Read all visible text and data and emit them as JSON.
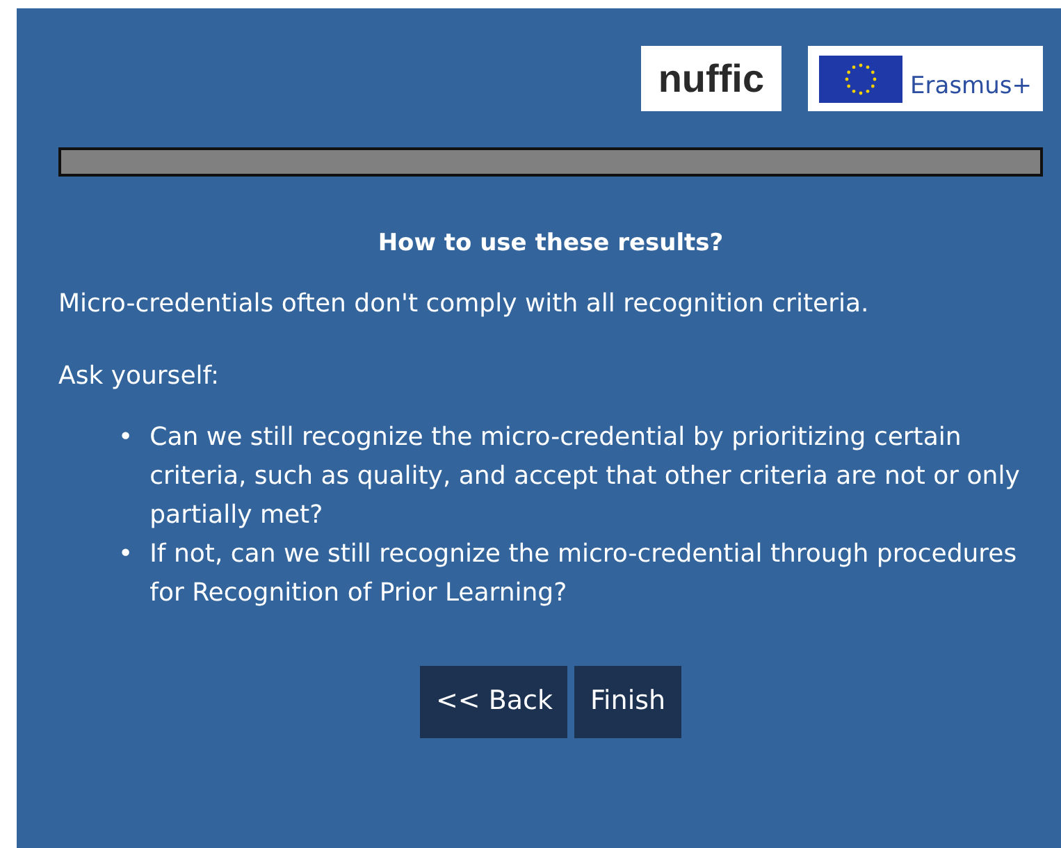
{
  "logos": [
    {
      "kind": "wordmark",
      "text": "nuffic"
    },
    {
      "kind": "flag",
      "text": "Erasmus+"
    }
  ],
  "progress": {
    "level": 1
  },
  "heading": "How to use these results?",
  "paragraphs": [
    "Micro-credentials often don't comply with all recognition criteria.",
    "Ask yourself:"
  ],
  "bullet_marker": "•",
  "bullets": [
    "Can we still recognize the micro-credential by prioritizing certain criteria, such as quality, and accept that other criteria are not or only partially met?",
    "If not, can we still recognize the micro-credential through procedures for Recognition of Prior Learning?"
  ],
  "buttons": [
    "<< Back",
    "Finish"
  ]
}
